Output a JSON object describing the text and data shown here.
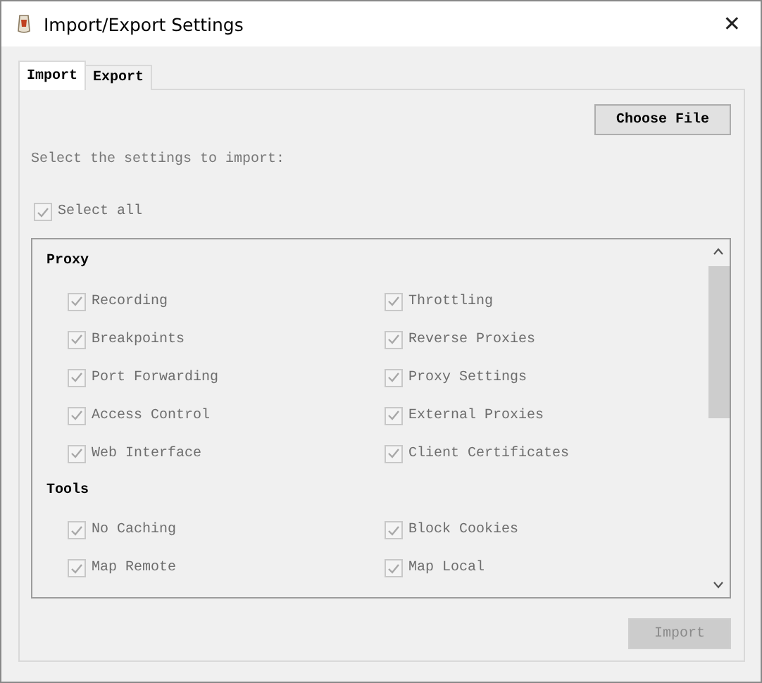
{
  "window": {
    "title": "Import/Export Settings",
    "close": "✕"
  },
  "tabs": [
    {
      "label": "Import",
      "selected": true
    },
    {
      "label": "Export",
      "selected": false
    }
  ],
  "choose_file_button": {
    "label": "Choose File",
    "disabled": false
  },
  "instruction": "Select the settings to import:",
  "select_all": {
    "label": "Select all",
    "checked": true,
    "disabled": true
  },
  "settings": {
    "disabled": true,
    "sections": [
      {
        "title": "Proxy",
        "items": [
          {
            "label": "Recording",
            "checked": true
          },
          {
            "label": "Throttling",
            "checked": true
          },
          {
            "label": "Breakpoints",
            "checked": true
          },
          {
            "label": "Reverse Proxies",
            "checked": true
          },
          {
            "label": "Port Forwarding",
            "checked": true
          },
          {
            "label": "Proxy Settings",
            "checked": true
          },
          {
            "label": "Access Control",
            "checked": true
          },
          {
            "label": "External Proxies",
            "checked": true
          },
          {
            "label": "Web Interface",
            "checked": true
          },
          {
            "label": "Client Certificates",
            "checked": true
          }
        ]
      },
      {
        "title": "Tools",
        "items": [
          {
            "label": "No Caching",
            "checked": true
          },
          {
            "label": "Block Cookies",
            "checked": true
          },
          {
            "label": "Map Remote",
            "checked": true
          },
          {
            "label": "Map Local",
            "checked": true
          }
        ]
      }
    ]
  },
  "import_button": {
    "label": "Import",
    "disabled": true
  }
}
